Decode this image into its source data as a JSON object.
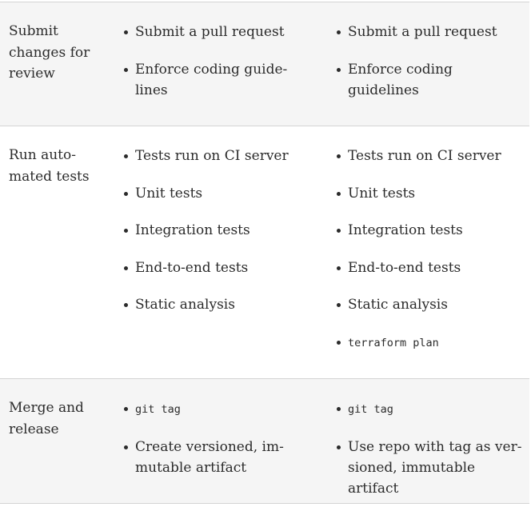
{
  "rows": [
    {
      "label": [
        "Submit",
        "changes for",
        "review"
      ],
      "col_a": [
        {
          "text": "Submit a pull request",
          "code": false
        },
        {
          "text": "Enforce coding guide-\nlines",
          "code": false
        }
      ],
      "col_b": [
        {
          "text": "Submit a pull request",
          "code": false
        },
        {
          "text": "Enforce coding guidelines",
          "code": false
        }
      ]
    },
    {
      "label": [
        "Run auto-",
        "mated tests"
      ],
      "col_a": [
        {
          "text": "Tests run on CI server",
          "code": false
        },
        {
          "text": "Unit tests",
          "code": false
        },
        {
          "text": "Integration tests",
          "code": false
        },
        {
          "text": "End-to-end tests",
          "code": false
        },
        {
          "text": "Static analysis",
          "code": false
        }
      ],
      "col_b": [
        {
          "text": "Tests run on CI server",
          "code": false
        },
        {
          "text": "Unit tests",
          "code": false
        },
        {
          "text": "Integration tests",
          "code": false
        },
        {
          "text": "End-to-end tests",
          "code": false
        },
        {
          "text": "Static analysis",
          "code": false
        },
        {
          "text": "terraform plan",
          "code": true
        }
      ]
    },
    {
      "label": [
        "Merge and",
        "release"
      ],
      "col_a": [
        {
          "text": "git tag",
          "code": true
        },
        {
          "text": "Create versioned, im-\nmutable artifact",
          "code": false
        }
      ],
      "col_b": [
        {
          "text": "git tag",
          "code": true
        },
        {
          "text": "Use repo with tag as ver-\nsioned, immutable artifact",
          "code": false
        }
      ]
    }
  ]
}
